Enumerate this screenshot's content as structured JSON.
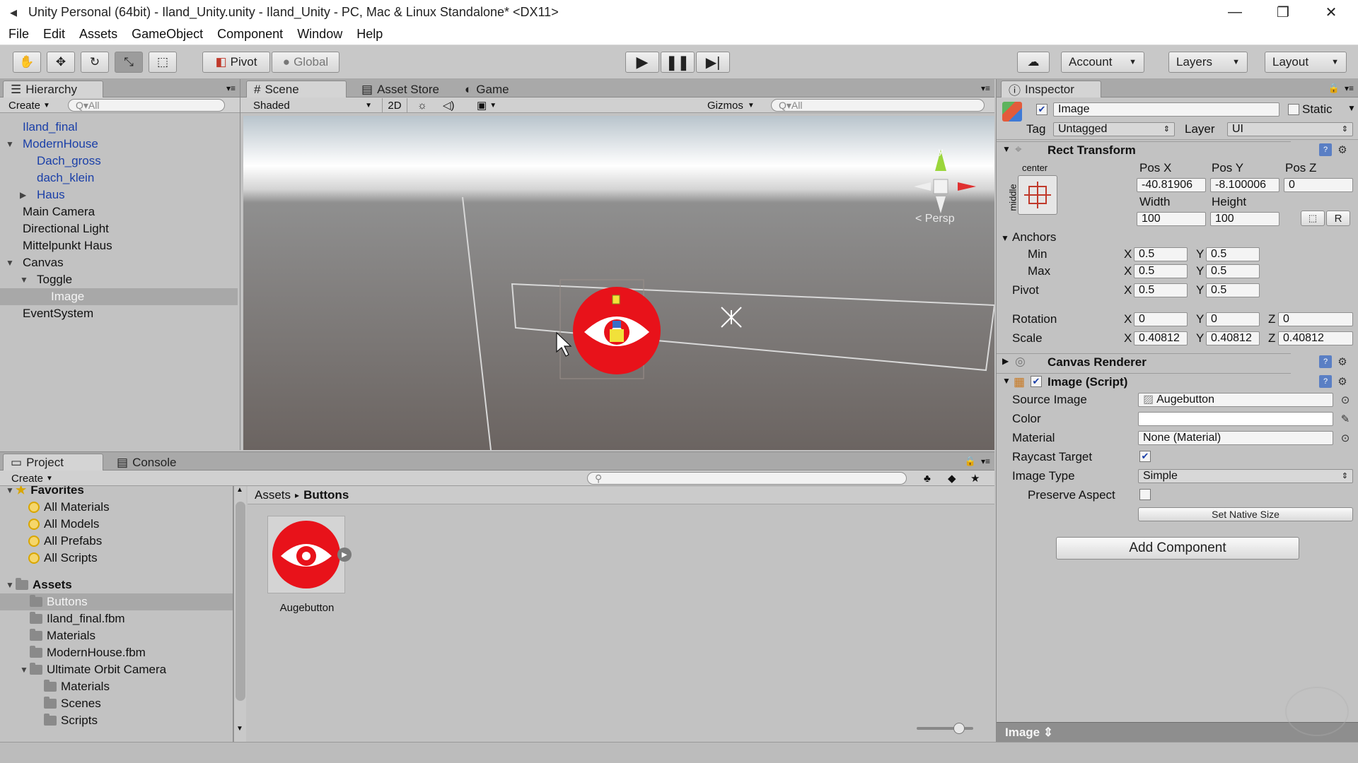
{
  "window": {
    "title": "Unity Personal (64bit) - Iland_Unity.unity - Iland_Unity - PC, Mac & Linux Standalone* <DX11>",
    "app_icon": "unity-logo-icon",
    "controls": [
      "minimize-icon",
      "restore-icon",
      "close-icon"
    ]
  },
  "menu": [
    "File",
    "Edit",
    "Assets",
    "GameObject",
    "Component",
    "Window",
    "Help"
  ],
  "toolbar": {
    "tools": [
      "hand-icon",
      "move-icon",
      "rotate-icon",
      "scale-icon",
      "rect-icon"
    ],
    "pivot_label": "Pivot",
    "global_label": "Global",
    "play_icon": "play-icon",
    "pause_icon": "pause-icon",
    "step_icon": "step-icon",
    "cloud_icon": "cloud-icon",
    "account_label": "Account",
    "layers_label": "Layers",
    "layout_label": "Layout"
  },
  "hierarchy": {
    "tab": "Hierarchy",
    "create_label": "Create",
    "search_placeholder": "Q▾All",
    "items": [
      {
        "label": "Iland_final",
        "indent": 0,
        "blue": true,
        "arrow": ""
      },
      {
        "label": "ModernHouse",
        "indent": 0,
        "blue": true,
        "arrow": "▼"
      },
      {
        "label": "Dach_gross",
        "indent": 1,
        "blue": true,
        "arrow": ""
      },
      {
        "label": "dach_klein",
        "indent": 1,
        "blue": true,
        "arrow": ""
      },
      {
        "label": "Haus",
        "indent": 1,
        "blue": true,
        "arrow": "▶"
      },
      {
        "label": "Main Camera",
        "indent": 0,
        "blue": false,
        "arrow": ""
      },
      {
        "label": "Directional Light",
        "indent": 0,
        "blue": false,
        "arrow": ""
      },
      {
        "label": "Mittelpunkt Haus",
        "indent": 0,
        "blue": false,
        "arrow": ""
      },
      {
        "label": "Canvas",
        "indent": 0,
        "blue": false,
        "arrow": "▼"
      },
      {
        "label": "Toggle",
        "indent": 1,
        "blue": false,
        "arrow": "▼"
      },
      {
        "label": "Image",
        "indent": 2,
        "blue": false,
        "arrow": "",
        "selected": true
      },
      {
        "label": "EventSystem",
        "indent": 0,
        "blue": false,
        "arrow": ""
      }
    ]
  },
  "scene": {
    "tabs": [
      "Scene",
      "Asset Store",
      "Game"
    ],
    "shading": "Shaded",
    "mode_2d": "2D",
    "gizmos_label": "Gizmos",
    "search_placeholder": "Q▾All",
    "persp_label": "< Persp"
  },
  "inspector": {
    "tab": "Inspector",
    "object_name": "Image",
    "static_label": "Static",
    "tag_label": "Tag",
    "tag_value": "Untagged",
    "layer_label": "Layer",
    "layer_value": "UI",
    "rect_transform": {
      "title": "Rect Transform",
      "anchor_h": "center",
      "anchor_v": "middle",
      "pos_x_label": "Pos X",
      "pos_y_label": "Pos Y",
      "pos_z_label": "Pos Z",
      "pos_x": "-40.81906",
      "pos_y": "-8.100006",
      "pos_z": "0",
      "width_label": "Width",
      "height_label": "Height",
      "width": "100",
      "height": "100",
      "raw_label": "R",
      "anchors_label": "Anchors",
      "min_label": "Min",
      "max_label": "Max",
      "min_x": "0.5",
      "min_y": "0.5",
      "max_x": "0.5",
      "max_y": "0.5",
      "pivot_label": "Pivot",
      "pivot_x": "0.5",
      "pivot_y": "0.5",
      "rotation_label": "Rotation",
      "rot_x": "0",
      "rot_y": "0",
      "rot_z": "0",
      "scale_label": "Scale",
      "scale_x": "0.40812",
      "scale_y": "0.40812",
      "scale_z": "0.40812",
      "x": "X",
      "y": "Y",
      "z": "Z"
    },
    "canvas_renderer": {
      "title": "Canvas Renderer"
    },
    "image_script": {
      "title": "Image (Script)",
      "source_image_label": "Source Image",
      "source_image": "Augebutton",
      "color_label": "Color",
      "material_label": "Material",
      "material": "None (Material)",
      "raycast_label": "Raycast Target",
      "image_type_label": "Image Type",
      "image_type": "Simple",
      "preserve_label": "Preserve Aspect",
      "native_size_label": "Set Native Size"
    },
    "add_component": "Add Component",
    "preview_label": "Image ⇕"
  },
  "project": {
    "tabs": [
      "Project",
      "Console"
    ],
    "create_label": "Create",
    "favorites_label": "Favorites",
    "favorites": [
      "All Materials",
      "All Models",
      "All Prefabs",
      "All Scripts"
    ],
    "assets_label": "Assets",
    "folders": [
      {
        "label": "Buttons",
        "indent": 1,
        "selected": true
      },
      {
        "label": "Iland_final.fbm",
        "indent": 1
      },
      {
        "label": "Materials",
        "indent": 1
      },
      {
        "label": "ModernHouse.fbm",
        "indent": 1
      },
      {
        "label": "Ultimate Orbit Camera",
        "indent": 1,
        "arrow": "▼"
      },
      {
        "label": "Materials",
        "indent": 2
      },
      {
        "label": "Scenes",
        "indent": 2
      },
      {
        "label": "Scripts",
        "indent": 2
      }
    ],
    "breadcrumb_root": "Assets",
    "breadcrumb_sep": "▸",
    "breadcrumb_current": "Buttons",
    "asset_name": "Augebutton"
  },
  "colors": {
    "accent_red": "#e8121a",
    "selection_blue": "#1a3fa8",
    "panel_bg": "#c2c2c2"
  }
}
